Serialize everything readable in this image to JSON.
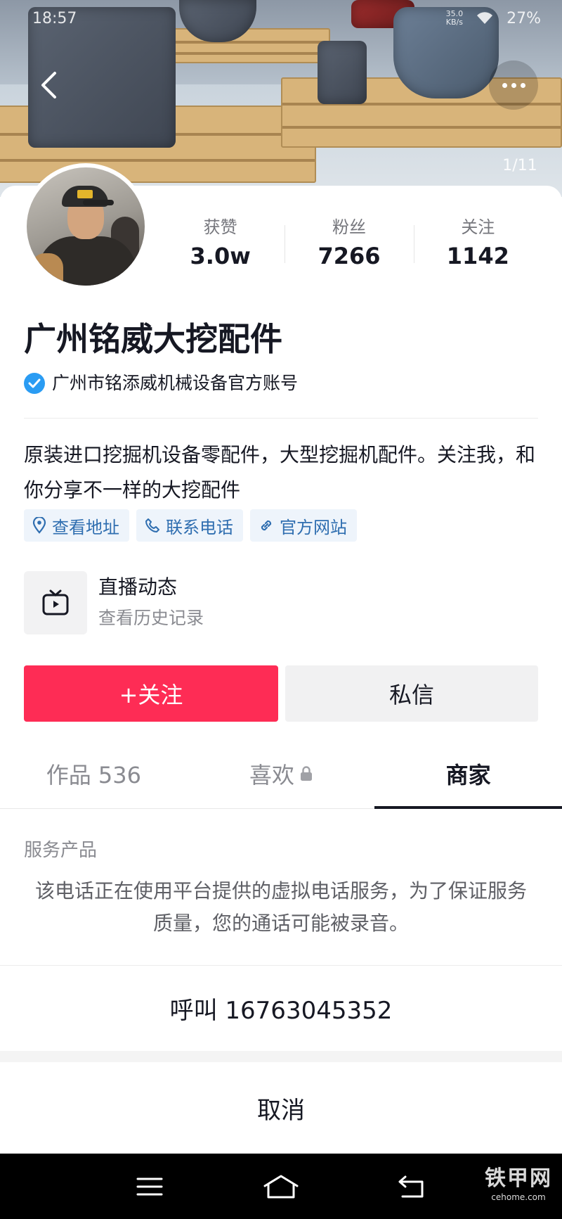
{
  "status_bar": {
    "time": "18:57",
    "net_speed": "35.0\nKB/s",
    "battery": "27%"
  },
  "cover": {
    "pager": "1/11"
  },
  "profile": {
    "stats": [
      {
        "label": "获赞",
        "value": "3.0w"
      },
      {
        "label": "粉丝",
        "value": "7266"
      },
      {
        "label": "关注",
        "value": "1142"
      }
    ],
    "name": "广州铭威大挖配件",
    "verified_text": "广州市铭添威机械设备官方账号",
    "bio": "原装进口挖掘机设备零配件，大型挖掘机配件。关注我，和你分享不一样的大挖配件",
    "chips": [
      {
        "label": "查看地址",
        "icon": "location-pin-icon"
      },
      {
        "label": "联系电话",
        "icon": "phone-icon"
      },
      {
        "label": "官方网站",
        "icon": "link-icon"
      }
    ],
    "live": {
      "title": "直播动态",
      "subtitle": "查看历史记录"
    },
    "follow_label": "+关注",
    "message_label": "私信"
  },
  "tabs": [
    {
      "label": "作品 536",
      "active": false
    },
    {
      "label": "喜欢",
      "active": false,
      "locked": true
    },
    {
      "label": "商家",
      "active": true
    }
  ],
  "sheet": {
    "section_label": "服务产品",
    "notice": "该电话正在使用平台提供的虚拟电话服务，为了保证服务质量，您的通话可能被录音。",
    "call_label": "呼叫 16763045352",
    "cancel_label": "取消"
  },
  "watermark": {
    "main": "铁甲网",
    "sub": "cehome.com"
  },
  "colors": {
    "accent": "#fe2c55",
    "link": "#2f6eb0",
    "verify": "#2a9cf3"
  }
}
